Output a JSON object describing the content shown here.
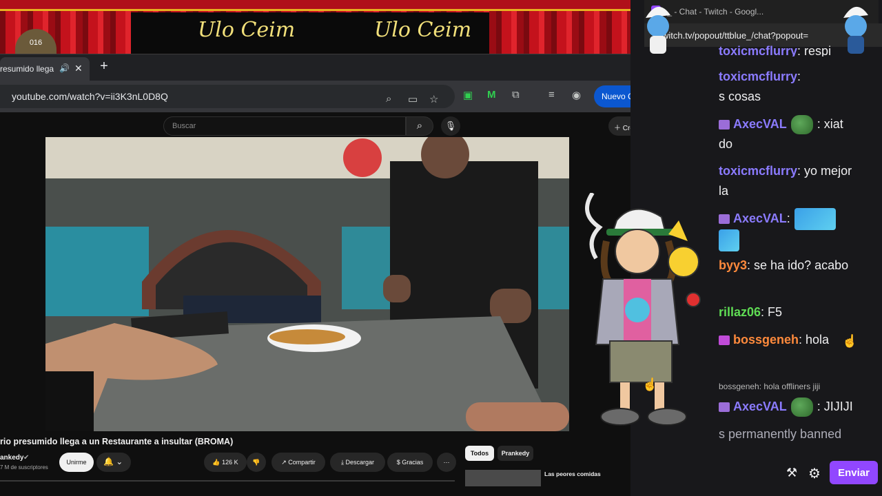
{
  "stream_overlay": {
    "welcome_text_left": "Ulo Ceim",
    "welcome_text_right": "Ulo Ceim",
    "badge_number": "016",
    "colors": {
      "curtain": "#c4121c",
      "banner_text": "#f2e07a"
    }
  },
  "browser": {
    "tab_title": "resumido llega",
    "url": "youtube.com/watch?v=ii3K3nL0D8Q",
    "update_button": "Nuevo Chrome disponible",
    "icons": [
      "zoom-icon",
      "cast-icon",
      "bookmark-star-icon",
      "extension-icon",
      "media-control-icon",
      "profile-icon"
    ]
  },
  "youtube": {
    "search_placeholder": "Buscar",
    "create_label": "Crear",
    "video_title": "rio presumido llega a un Restaurante a insultar (BROMA)",
    "channel_name": "ankedy",
    "subscribers": "7 M de suscriptores",
    "subscribe_label": "Unirme",
    "likes": "126 K",
    "share_label": "Compartir",
    "download_label": "Descargar",
    "thanks_label": "Gracias",
    "chips": [
      "Todos",
      "Prankedy"
    ],
    "recommended_title": "Las peores comidas"
  },
  "chat": {
    "window_title": "ue_ - Chat - Twitch - Googl...",
    "popout_url": "witch.tv/popout/ttblue_/chat?popout=",
    "messages": [
      {
        "user": "toxicmcflurry",
        "text": ": respi"
      },
      {
        "user": "toxicmcflurry",
        "text": ":"
      },
      {
        "user": "",
        "text": "s cosas"
      },
      {
        "user": "AxecVAL",
        "text": ": xiat"
      },
      {
        "user": "",
        "text": "do"
      },
      {
        "user": "toxicmcflurry",
        "text": ": yo mejor"
      },
      {
        "user": "",
        "text": "la"
      },
      {
        "user": "AxecVAL",
        "text": ":"
      },
      {
        "user": "byy3",
        "text": ": se ha ido? acabo"
      },
      {
        "user": "rillaz06",
        "text": ": F5"
      },
      {
        "user": "bossgeneh",
        "text": ": hola"
      },
      {
        "user": "",
        "text": "bossgeneh: hola offliners jiji"
      },
      {
        "user": "AxecVAL",
        "text": ": JIJIJI"
      },
      {
        "user": "",
        "text": "s permanently banned"
      }
    ],
    "send_label": "Enviar",
    "colors": {
      "send": "#9147ff",
      "purple_user": "#8b7bff",
      "orange_user": "#ff8a3c"
    }
  }
}
